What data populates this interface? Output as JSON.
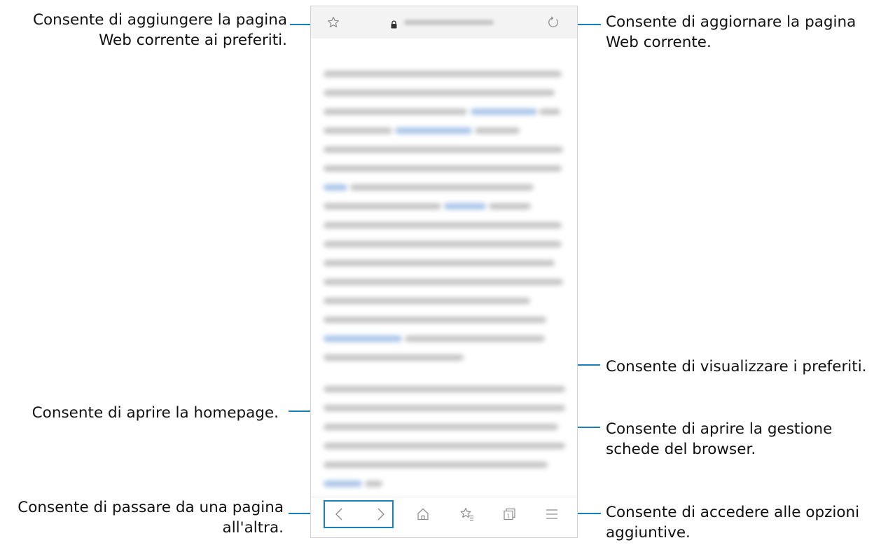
{
  "callouts": {
    "add_bookmark": [
      "Consente di aggiungere la pagina",
      "Web corrente ai preferiti."
    ],
    "refresh": [
      "Consente di aggiornare la pagina",
      "Web corrente."
    ],
    "view_bookmarks": [
      "Consente di visualizzare i preferiti."
    ],
    "home": [
      "Consente di aprire la homepage."
    ],
    "tabs": [
      "Consente di aprire la gestione",
      "schede del browser."
    ],
    "navigate": [
      "Consente di passare da una pagina",
      "all'altra."
    ],
    "options": [
      "Consente di accedere alle opzioni",
      "aggiuntive."
    ]
  },
  "browser": {
    "url_bar_icons": [
      "star-outline-icon",
      "lock-icon",
      "refresh-icon"
    ],
    "bottom_bar_icons": [
      "chevron-left-icon",
      "chevron-right-icon",
      "home-icon",
      "bookmarks-icon",
      "tabs-icon",
      "menu-icon"
    ],
    "tab_count": "1"
  },
  "colors": {
    "accent": "#1a7fb8",
    "icon": "#8a8a8a",
    "url_bar_bg": "#f3f3f3",
    "text": "#111111"
  }
}
